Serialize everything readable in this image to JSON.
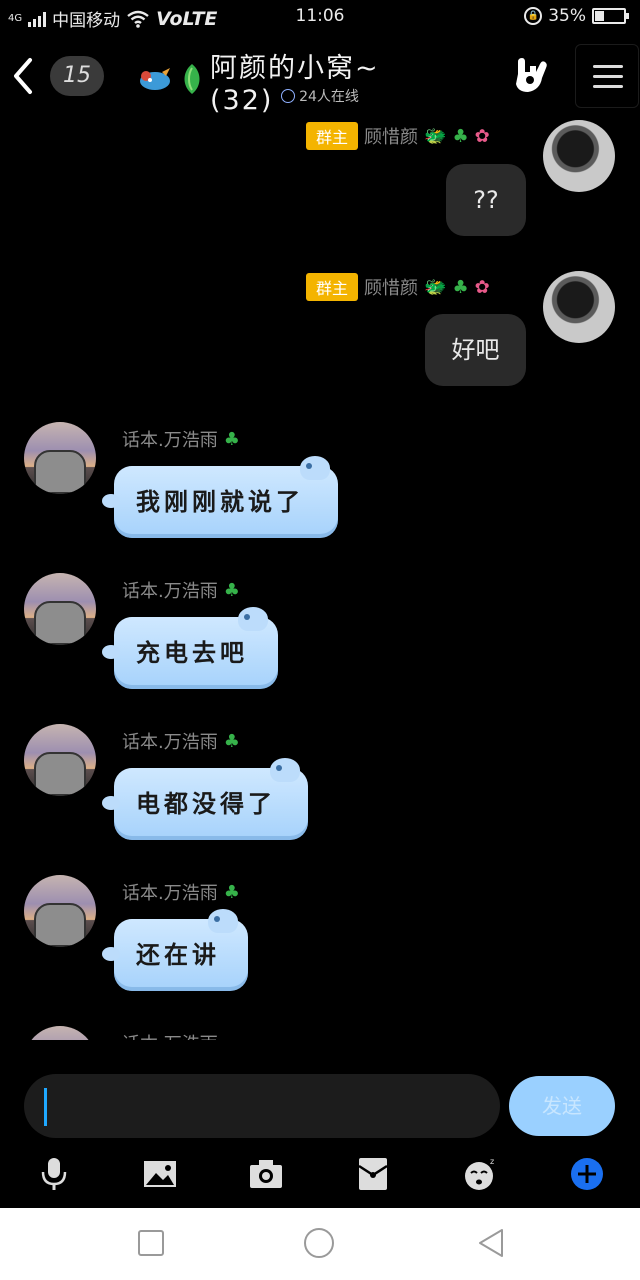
{
  "status_bar": {
    "network": "4G",
    "carrier": "中国移动",
    "volte": "VoLTE",
    "time": "11:06",
    "battery_percent": "35%",
    "battery_level": 0.35
  },
  "header": {
    "unread_count": "15",
    "title": "阿颜的小窝~(32)",
    "online_text": "24人在线"
  },
  "messages": [
    {
      "side": "right",
      "badge": "群主",
      "nickname": "顾惜颜",
      "text": "??"
    },
    {
      "side": "right",
      "badge": "群主",
      "nickname": "顾惜颜",
      "text": "好吧"
    },
    {
      "side": "left",
      "nickname": "话本.万浩雨",
      "text": "我刚刚就说了"
    },
    {
      "side": "left",
      "nickname": "话本.万浩雨",
      "text": "充电去吧"
    },
    {
      "side": "left",
      "nickname": "话本.万浩雨",
      "text": "电都没得了"
    },
    {
      "side": "left",
      "nickname": "话本.万浩雨",
      "text": "还在讲"
    },
    {
      "side": "left",
      "nickname": "话本.万浩雨",
      "text": ""
    }
  ],
  "composer": {
    "value": "",
    "send_label": "发送"
  },
  "toolbar_icons": [
    "microphone-icon",
    "image-icon",
    "camera-icon",
    "red-packet-icon",
    "sticker-icon",
    "plus-icon"
  ],
  "nav_icons": [
    "recents-square-icon",
    "home-circle-icon",
    "back-triangle-icon"
  ],
  "colors": {
    "accent_blue": "#1fa8ff",
    "send_button": "#9ad0ff",
    "owner_badge": "#f4b400",
    "bubble_blue": "#a6d2fb"
  }
}
